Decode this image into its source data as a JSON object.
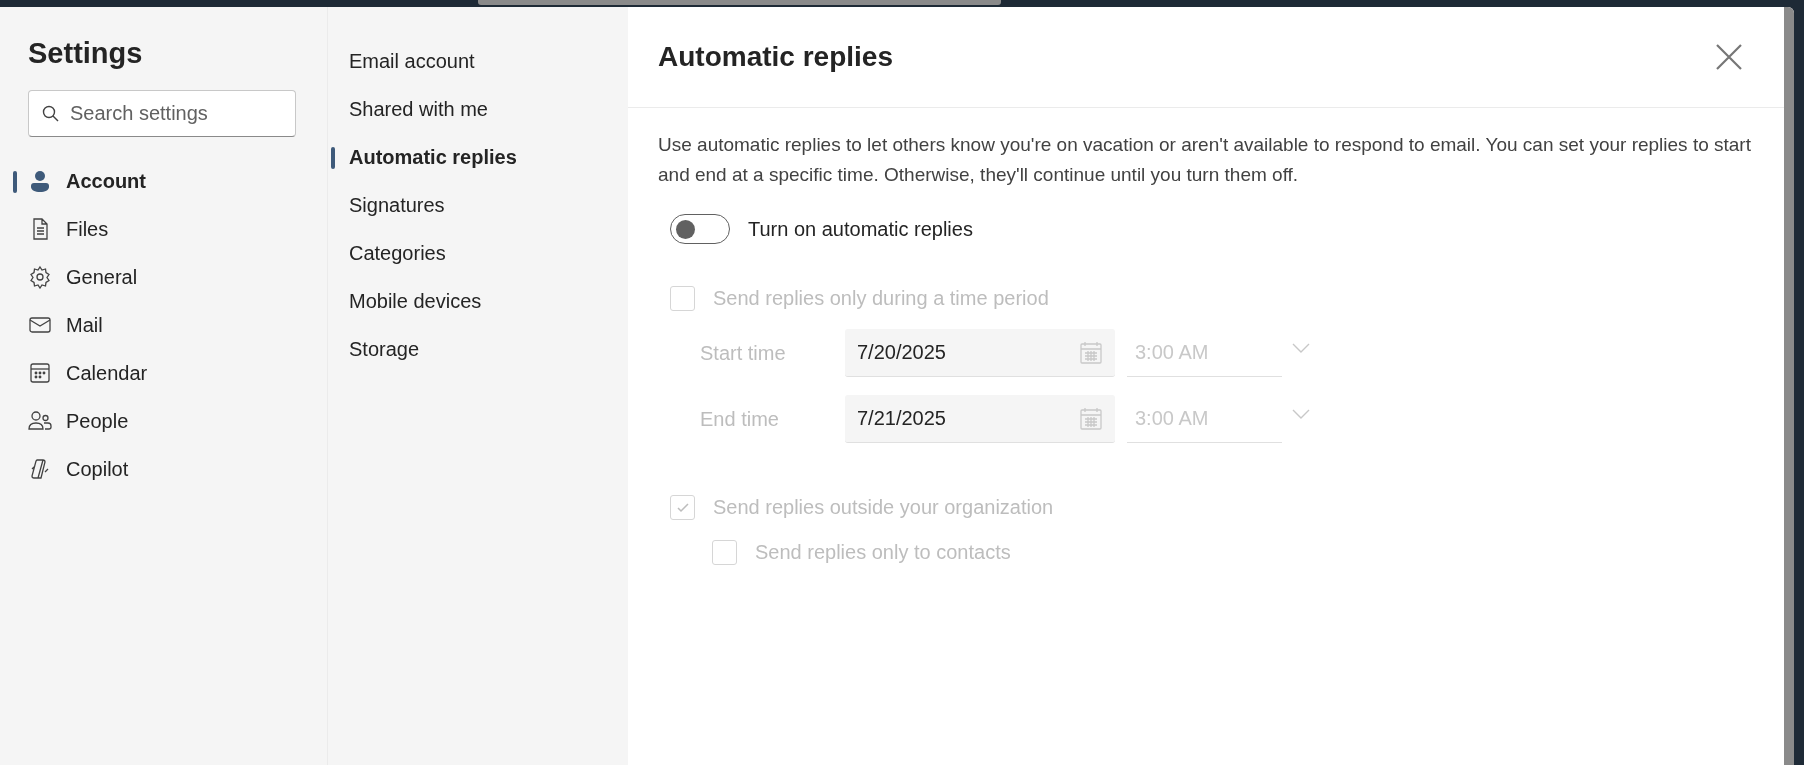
{
  "sidebar": {
    "title": "Settings",
    "search": {
      "placeholder": "Search settings"
    },
    "items": [
      {
        "label": "Account",
        "selected": true
      },
      {
        "label": "Files",
        "selected": false
      },
      {
        "label": "General",
        "selected": false
      },
      {
        "label": "Mail",
        "selected": false
      },
      {
        "label": "Calendar",
        "selected": false
      },
      {
        "label": "People",
        "selected": false
      },
      {
        "label": "Copilot",
        "selected": false
      }
    ]
  },
  "subnav": {
    "items": [
      {
        "label": "Email account",
        "selected": false
      },
      {
        "label": "Shared with me",
        "selected": false
      },
      {
        "label": "Automatic replies",
        "selected": true
      },
      {
        "label": "Signatures",
        "selected": false
      },
      {
        "label": "Categories",
        "selected": false
      },
      {
        "label": "Mobile devices",
        "selected": false
      },
      {
        "label": "Storage",
        "selected": false
      }
    ]
  },
  "panel": {
    "title": "Automatic replies",
    "description": "Use automatic replies to let others know you're on vacation or aren't available to respond to email. You can set your replies to start and end at a specific time. Otherwise, they'll continue until you turn them off.",
    "toggle": {
      "label": "Turn on automatic replies",
      "on": false
    },
    "time_period": {
      "label": "Send replies only during a time period",
      "checked": false,
      "disabled": true
    },
    "times": [
      {
        "label": "Start time",
        "date": "7/20/2025",
        "time": "3:00 AM",
        "disabled": true
      },
      {
        "label": "End time",
        "date": "7/21/2025",
        "time": "3:00 AM",
        "disabled": true
      }
    ],
    "outside": {
      "label": "Send replies outside your organization",
      "checked": true,
      "disabled": true
    },
    "contacts": {
      "label": "Send replies only to contacts",
      "checked": false,
      "disabled": true
    }
  }
}
